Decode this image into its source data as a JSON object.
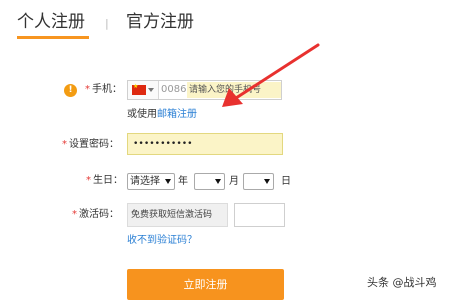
{
  "tabs": {
    "personal": "个人注册",
    "separator": "|",
    "official": "官方注册"
  },
  "phone": {
    "label": "手机：",
    "country_code": "0086",
    "placeholder": "请输入您的手机号",
    "alt_prefix": "或使用",
    "alt_link": "邮箱注册"
  },
  "password": {
    "label": "设置密码：",
    "masked_value": "•••••••••••"
  },
  "birthday": {
    "label": "生日：",
    "year_selected": "请选择",
    "year_unit": "年",
    "month_unit": "月",
    "day_unit": "日"
  },
  "activation": {
    "label": "激活码：",
    "sms_button": "免费获取短信激活码",
    "no_code_link": "收不到验证码？"
  },
  "submit_label": "立即注册",
  "watermark": "头条 @战斗鸡",
  "colors": {
    "accent": "#f7931e",
    "required": "#e53935",
    "link": "#2a7fd4",
    "annotation_arrow": "#e8312f"
  }
}
